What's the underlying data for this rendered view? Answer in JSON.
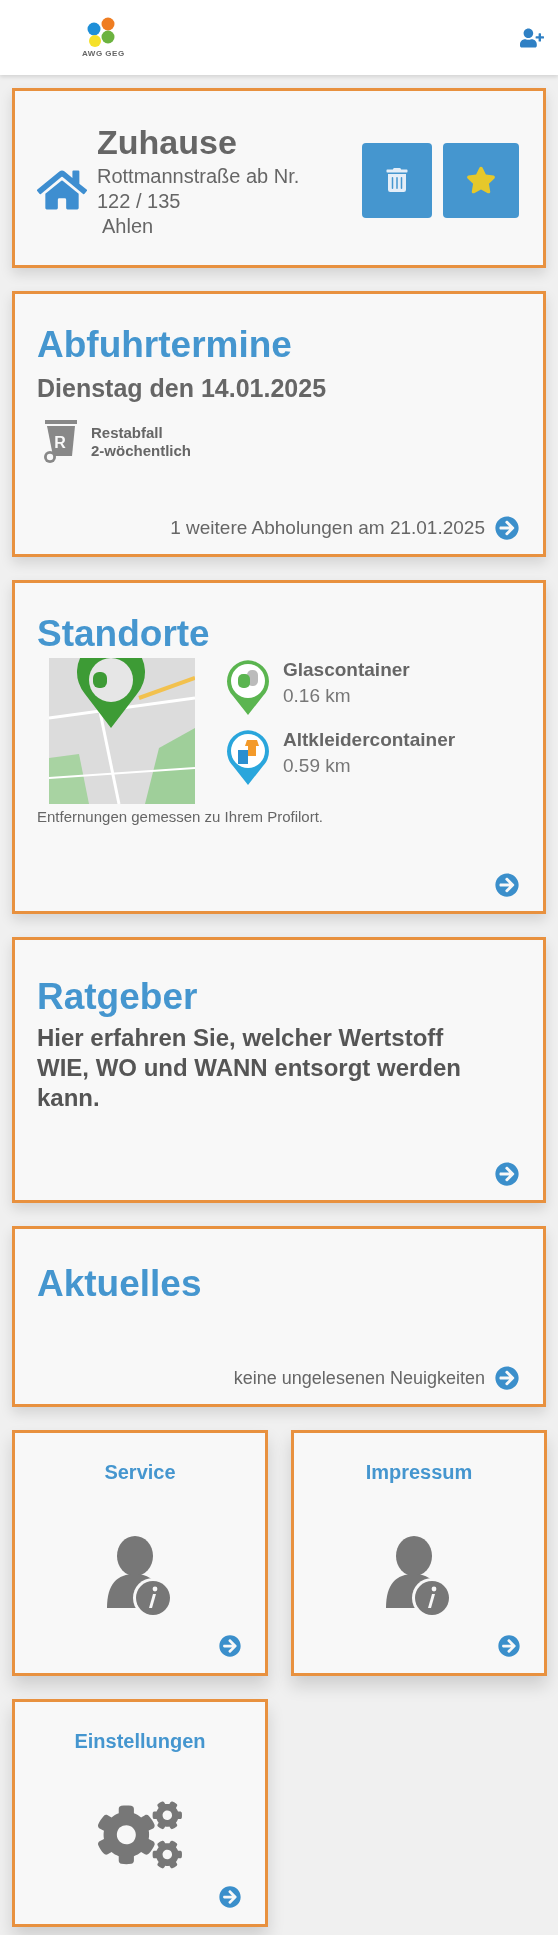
{
  "header": {
    "logo_text": "AWG GEG"
  },
  "home": {
    "title": "Zuhause",
    "street": "Rottmannstraße ab Nr.",
    "number": "122 / 135",
    "city": "Ahlen",
    "favorite": true
  },
  "pickups": {
    "title": "Abfuhrtermine",
    "date": "Dienstag den 14.01.2025",
    "waste_letter": "R",
    "waste_name": "Restabfall",
    "frequency": "2-wöchentlich",
    "more": "1 weitere Abholungen am 21.01.2025"
  },
  "locations": {
    "title": "Standorte",
    "items": [
      {
        "kind": "glass",
        "name": "Glascontainer",
        "distance": "0.16 km"
      },
      {
        "kind": "clothes",
        "name": "Altkleidercontainer",
        "distance": "0.59 km"
      }
    ],
    "note": "Entfernungen gemessen zu Ihrem Profilort."
  },
  "guide": {
    "title": "Ratgeber",
    "text": "Hier erfahren Sie, welcher Wertstoff WIE, WO und WANN entsorgt werden kann."
  },
  "news": {
    "title": "Aktuelles",
    "status": "keine ungelesenen Neuigkeiten"
  },
  "tiles": [
    {
      "kind": "info",
      "title": "Service"
    },
    {
      "kind": "info",
      "title": "Impressum"
    },
    {
      "kind": "settings",
      "title": "Einstellungen"
    }
  ]
}
